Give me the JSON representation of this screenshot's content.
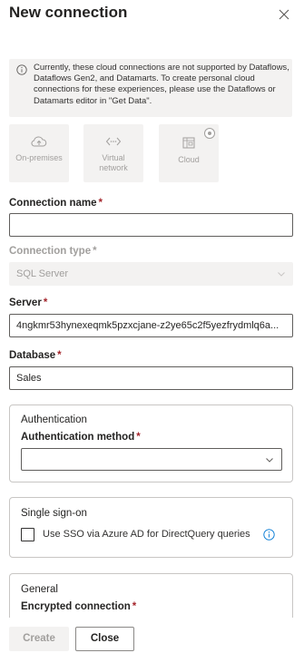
{
  "dialog": {
    "title": "New connection"
  },
  "info": {
    "text": "Currently, these cloud connections are not supported by Dataflows, Dataflows Gen2, and Datamarts. To create personal cloud connections for these experiences, please use the Dataflows or Datamarts editor in \"Get Data\"."
  },
  "tiles": [
    {
      "label": "On-premises",
      "icon": "cloud-upload-icon"
    },
    {
      "label": "Virtual network",
      "icon": "virtual-network-icon"
    },
    {
      "label": "Cloud",
      "icon": "cloud-building-icon",
      "selected": true
    }
  ],
  "fields": {
    "connection_name": {
      "label": "Connection name",
      "value": ""
    },
    "connection_type": {
      "label": "Connection type",
      "value": "SQL Server"
    },
    "server": {
      "label": "Server",
      "value": "4ngkmr53hynexeqmk5pzxcjane-z2ye65c2f5yezfrydmlq6a..."
    },
    "database": {
      "label": "Database",
      "value": "Sales"
    }
  },
  "authentication": {
    "title": "Authentication",
    "method_label": "Authentication method",
    "method_value": ""
  },
  "sso": {
    "title": "Single sign-on",
    "checkbox_label": "Use SSO via Azure AD for DirectQuery queries",
    "checked": false
  },
  "general": {
    "title": "General",
    "encrypted_label": "Encrypted connection"
  },
  "required_marker": "*",
  "footer": {
    "create_label": "Create",
    "close_label": "Close"
  }
}
